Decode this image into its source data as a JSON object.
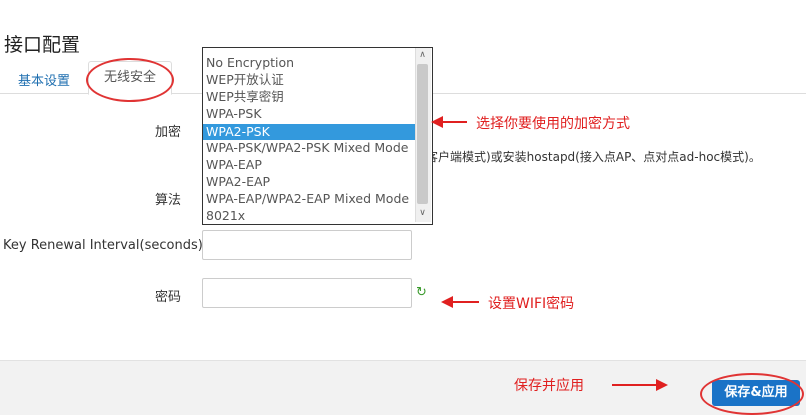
{
  "page": {
    "title": "接口配置"
  },
  "tabs": [
    {
      "label": "基本设置"
    },
    {
      "label": "无线安全"
    }
  ],
  "form": {
    "encryption_label": "加密",
    "algorithm_label": "算法",
    "key_renewal_label": "Key Renewal Interval(seconds)",
    "password_label": "密码",
    "help_text": "客户端模式)或安装hostapd(接入点AP、点对点ad-hoc模式)。",
    "key_renewal_value": "",
    "password_value": ""
  },
  "dropdown": {
    "selected": "WPA2-PSK",
    "options": [
      "No Encryption",
      "WEP开放认证",
      "WEP共享密钥",
      "WPA-PSK",
      "WPA2-PSK",
      "WPA-PSK/WPA2-PSK Mixed Mode",
      "WPA-EAP",
      "WPA2-EAP",
      "WPA-EAP/WPA2-EAP Mixed Mode",
      "8021x"
    ]
  },
  "annotations": {
    "encryption_note": "选择你要使用的加密方式",
    "password_note": "设置WIFI密码",
    "save_note": "保存并应用"
  },
  "footer": {
    "save_apply_label": "保存&应用"
  },
  "colors": {
    "accent": "#1a73c7",
    "annotation": "#e02020",
    "selected": "#3399dd"
  },
  "icons": {
    "refresh": "refresh-icon"
  }
}
